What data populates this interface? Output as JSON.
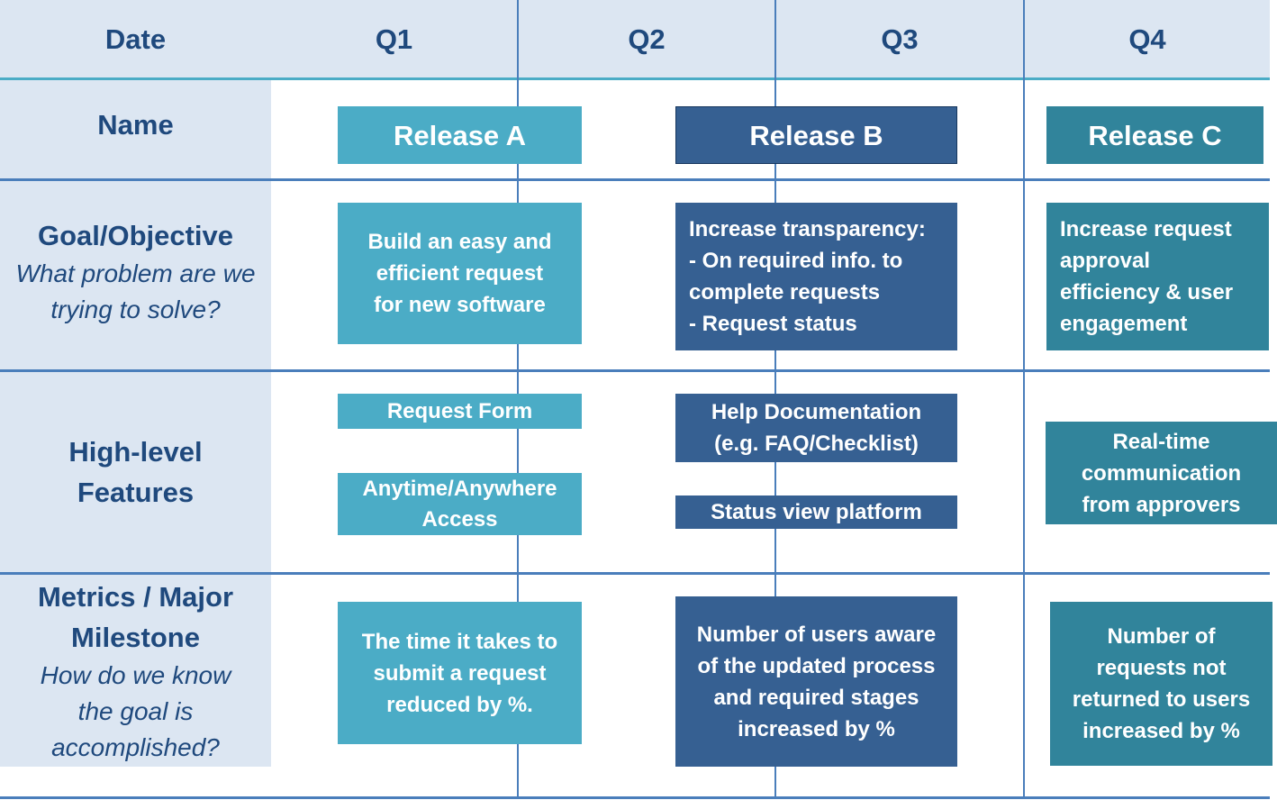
{
  "header": {
    "date_label": "Date",
    "quarters": [
      "Q1",
      "Q2",
      "Q3",
      "Q4"
    ]
  },
  "rows": {
    "name": {
      "title": "Name"
    },
    "goal": {
      "title": "Goal/Objective",
      "subtitle": "What problem are we trying to solve?"
    },
    "features": {
      "title": "High-level Features"
    },
    "metrics": {
      "title": "Metrics / Major Milestone",
      "subtitle": "How do we know the goal is accomplished?"
    }
  },
  "colors": {
    "release_a": "#4bacc6",
    "release_b": "#366092",
    "release_c": "#31849b",
    "label_bg": "#dce6f2",
    "label_text": "#1f497d",
    "grid_line": "#4a7ebb"
  },
  "releases": [
    {
      "name": "Release A",
      "goal": "Build an easy and\nefficient  request\nfor new software",
      "features": [
        "Request Form",
        "Anytime/Anywhere\nAccess"
      ],
      "metric": "The time it takes to\nsubmit a request\nreduced by %."
    },
    {
      "name": "Release B",
      "goal": "Increase transparency:\n- On required info.  to\ncomplete requests\n- Request status",
      "features": [
        "Help Documentation\n(e.g. FAQ/Checklist)",
        "Status view platform"
      ],
      "metric": "Number of users aware\nof the updated process\nand required stages\nincreased by %"
    },
    {
      "name": "Release C",
      "goal": "Increase request\napproval\nefficiency & user\nengagement",
      "features": [
        "Real-time\ncommunication\nfrom approvers"
      ],
      "metric": "Number of\nrequests not\nreturned to users\nincreased by %"
    }
  ]
}
